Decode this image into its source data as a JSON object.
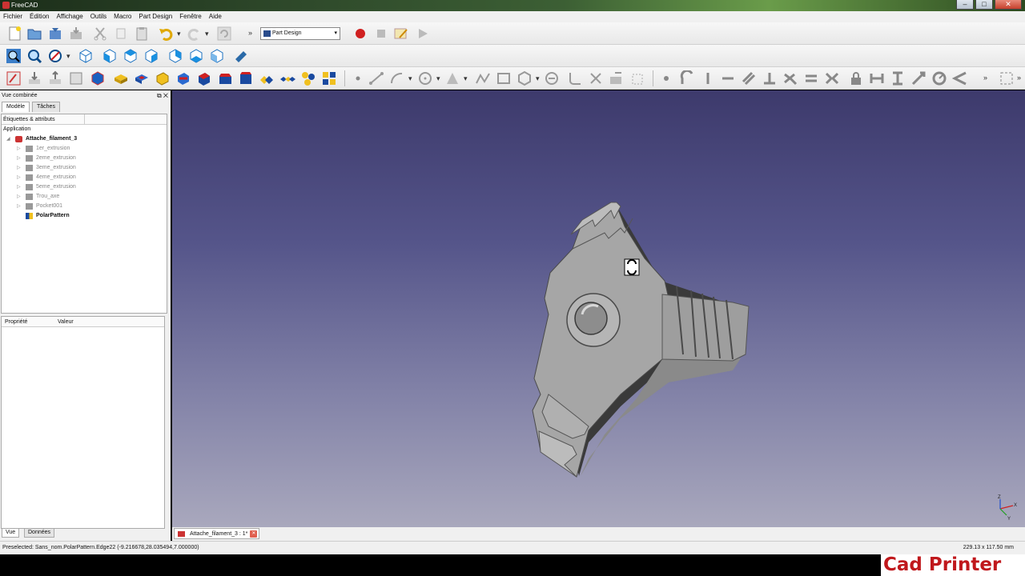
{
  "window": {
    "title": "FreeCAD"
  },
  "menu": [
    "Fichier",
    "Édition",
    "Affichage",
    "Outils",
    "Macro",
    "Part Design",
    "Fenêtre",
    "Aide"
  ],
  "workbench": {
    "selected": "Part Design"
  },
  "combo": {
    "title": "Vue combinée",
    "tabs": [
      "Modèle",
      "Tâches"
    ],
    "tree_header": "Étiquettes & attributs",
    "root": "Application",
    "document": "Attache_filament_3",
    "items": [
      {
        "label": "1er_extrusion",
        "state": "hidden"
      },
      {
        "label": "2eme_extrusion",
        "state": "hidden"
      },
      {
        "label": "3eme_extrusion",
        "state": "hidden"
      },
      {
        "label": "4eme_extrusion",
        "state": "hidden"
      },
      {
        "label": "5eme_extrusion",
        "state": "hidden"
      },
      {
        "label": "Trou_axe",
        "state": "hidden"
      },
      {
        "label": "Pocket001",
        "state": "hidden"
      },
      {
        "label": "PolarPattern",
        "state": "visible"
      }
    ],
    "prop_headers": [
      "Propriété",
      "Valeur"
    ],
    "bottom_tabs": [
      "Vue",
      "Données"
    ]
  },
  "doc_tab": {
    "label": "Attache_filament_3 : 1*"
  },
  "status": {
    "message": "Preselected: Sans_nom.PolarPattern.Edge22 (-9.216678,28.035494,7.000000)",
    "dimensions": "229.13 x 117.50 mm"
  },
  "watermark": "Cad Printer",
  "colors": {
    "viewport_top": "#3d3a6c",
    "viewport_bottom": "#a9a8bd",
    "model": "#a4a4a4",
    "record": "#d02020"
  }
}
